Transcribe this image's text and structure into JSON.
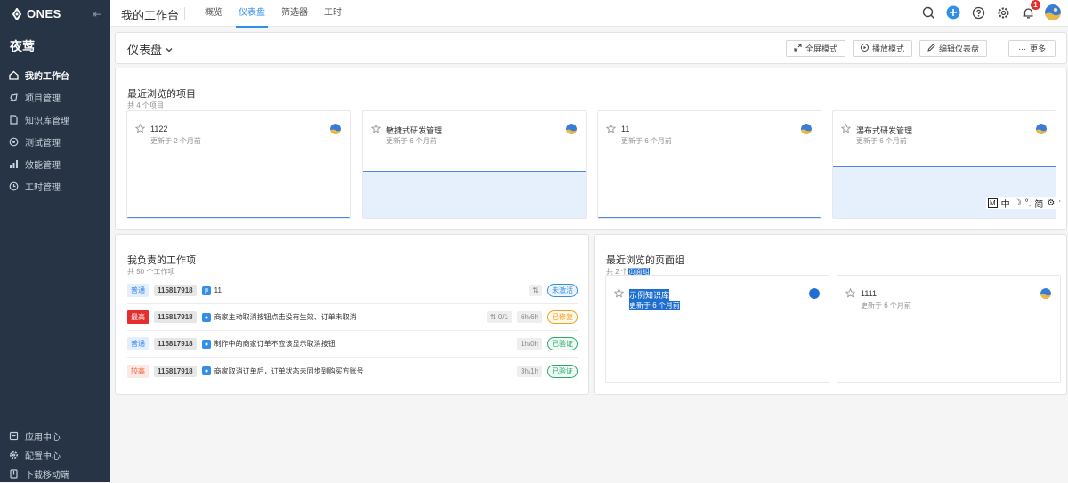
{
  "sidebar": {
    "logo": "ONES",
    "team": "夜莺",
    "items": [
      {
        "label": "我的工作台",
        "icon": "home-icon",
        "active": true
      },
      {
        "label": "项目管理",
        "icon": "rocket-icon"
      },
      {
        "label": "知识库管理",
        "icon": "document-icon"
      },
      {
        "label": "测试管理",
        "icon": "test-icon"
      },
      {
        "label": "效能管理",
        "icon": "bar-chart-icon"
      },
      {
        "label": "工时管理",
        "icon": "clock-icon"
      }
    ],
    "bottom": [
      {
        "label": "应用中心",
        "icon": "app-icon"
      },
      {
        "label": "配置中心",
        "icon": "gear-icon"
      },
      {
        "label": "下载移动端",
        "icon": "mobile-icon"
      }
    ]
  },
  "topbar": {
    "title": "我的工作台",
    "tabs": [
      "概览",
      "仪表盘",
      "筛选器",
      "工时"
    ],
    "active_tab": "仪表盘",
    "notification_count": "1"
  },
  "dashboard": {
    "title": "仪表盘",
    "buttons": {
      "fullscreen": "全屏模式",
      "play": "播放模式",
      "edit": "编辑仪表盘",
      "more": "更多"
    }
  },
  "recent_projects": {
    "title": "最近浏览的项目",
    "subtitle": "共 4 个项目",
    "items": [
      {
        "name": "1122",
        "updated": "更新于 2 个月前"
      },
      {
        "name": "敏捷式研发管理",
        "updated": "更新于 6 个月前"
      },
      {
        "name": "11",
        "updated": "更新于 6 个月前"
      },
      {
        "name": "瀑布式研发管理",
        "updated": "更新于 6 个月前"
      }
    ]
  },
  "ime_toolbar": {
    "m": "M",
    "zh": "中",
    "moon": "☽",
    "punct": "°,",
    "simp": "简"
  },
  "my_work_items": {
    "title": "我负责的工作项",
    "subtitle": "共 50 个工作项",
    "items": [
      {
        "priority": "普通",
        "id": "115817918",
        "title": "11",
        "subtask": "",
        "hours": "",
        "status": "未激活"
      },
      {
        "priority": "最高",
        "id": "115817918",
        "title": "商家主动取消按钮点击没有生效、订单未取消",
        "subtask": "0/1",
        "hours": "6h/6h",
        "status": "已修复"
      },
      {
        "priority": "普通",
        "id": "115817918",
        "title": "制作中的商家订单不应该显示取消按钮",
        "subtask": "",
        "hours": "1h/0h",
        "status": "已验证"
      },
      {
        "priority": "较高",
        "id": "115817918",
        "title": "商家取消订单后，订单状态未同步到购买方账号",
        "subtask": "",
        "hours": "3h/1h",
        "status": "已验证"
      }
    ]
  },
  "recent_pages": {
    "title": "最近浏览的页面组",
    "subtitle_prefix": "共 2 个",
    "subtitle_highlight": "页面组",
    "items": [
      {
        "name": "示例知识库",
        "updated": "更新于 6 个月前"
      },
      {
        "name": "1111",
        "updated": "更新于 6 个月前"
      }
    ]
  },
  "colors": {
    "accent": "#338fe5",
    "sidebar": "#263445",
    "danger": "#e52e2e"
  }
}
